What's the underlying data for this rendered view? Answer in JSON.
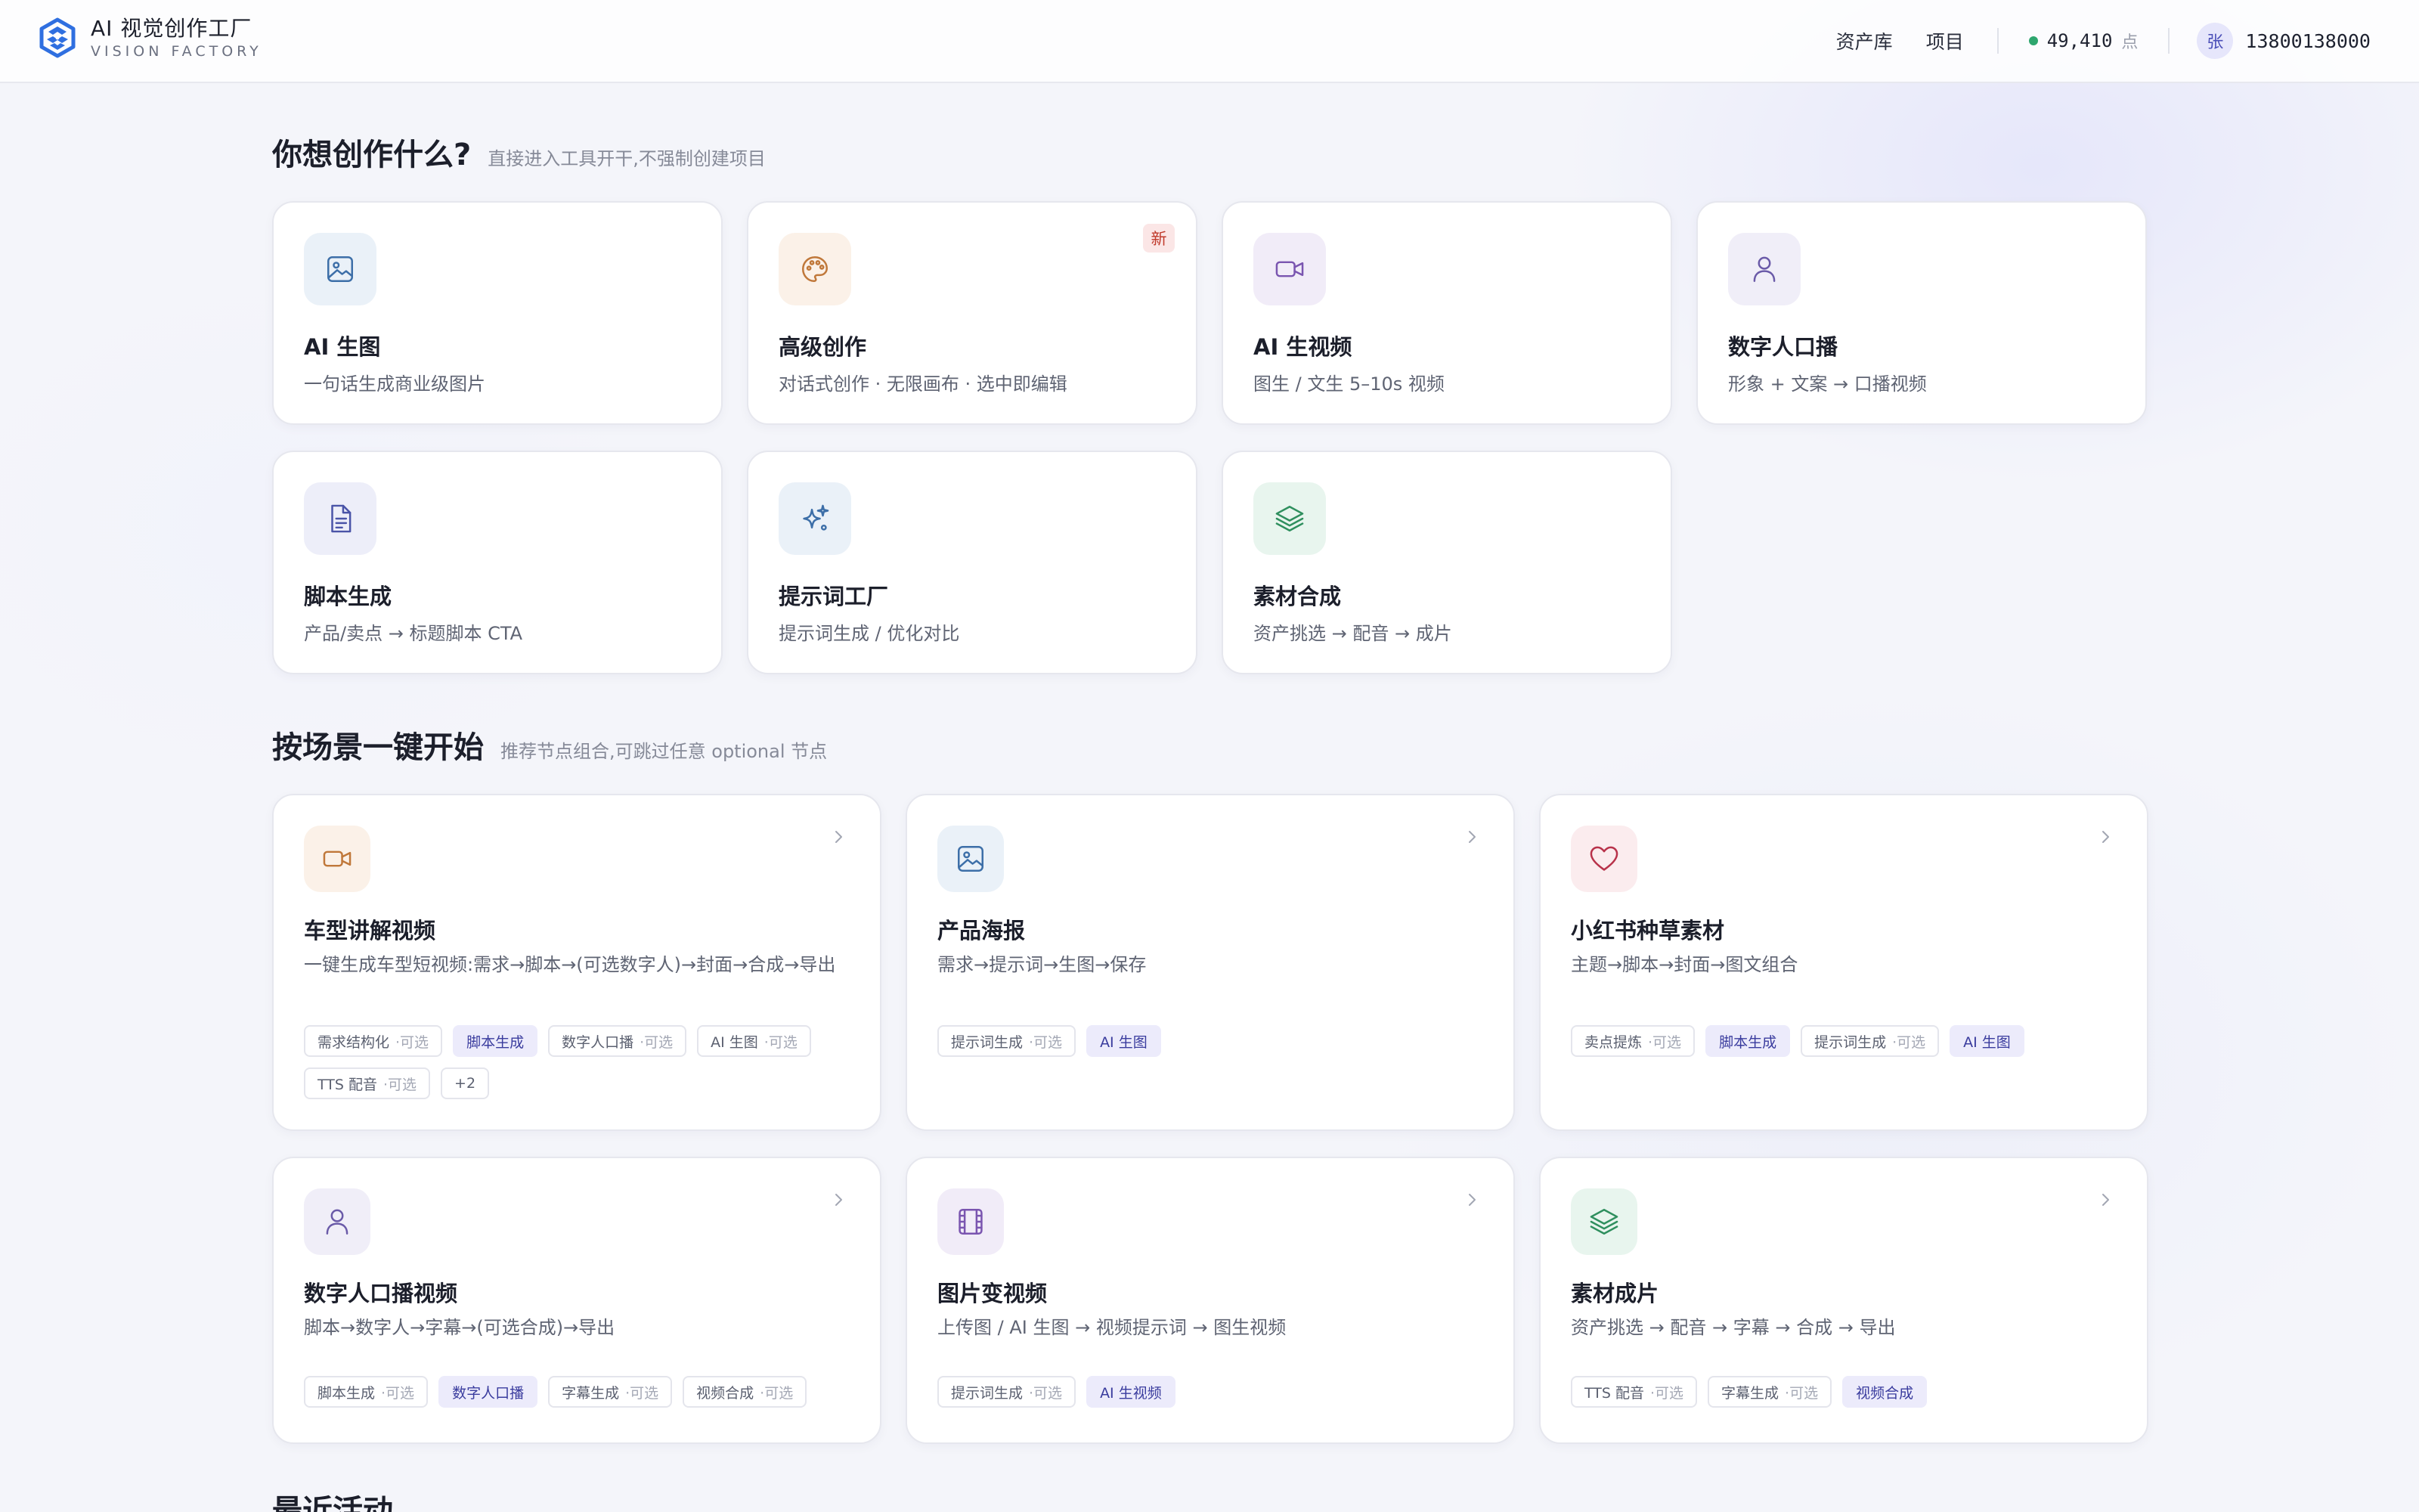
{
  "brand": {
    "title": "AI 视觉创作工厂",
    "subtitle": "VISION FACTORY"
  },
  "nav": {
    "assets": "资产库",
    "projects": "项目",
    "credits": "49,410",
    "credits_unit": "点",
    "avatar_initial": "张",
    "user_phone": "13800138000"
  },
  "tools_section": {
    "title": "你想创作什么?",
    "subtitle": "直接进入工具开干,不强制创建项目",
    "cards": [
      {
        "icon": "image-icon",
        "title": "AI 生图",
        "desc": "一句话生成商业级图片",
        "color": "#3d6fa8",
        "bg": "#eaf1f8"
      },
      {
        "icon": "palette-icon",
        "title": "高级创作",
        "desc": "对话式创作 · 无限画布 · 选中即编辑",
        "color": "#c0783a",
        "bg": "#fbf1e8",
        "badge": "新"
      },
      {
        "icon": "video-icon",
        "title": "AI 生视频",
        "desc": "图生 / 文生 5–10s 视频",
        "color": "#7a55b0",
        "bg": "#f1ecf8"
      },
      {
        "icon": "person-icon",
        "title": "数字人口播",
        "desc": "形象 + 文案 → 口播视频",
        "color": "#6a5aa8",
        "bg": "#f0eef8"
      },
      {
        "icon": "document-icon",
        "title": "脚本生成",
        "desc": "产品/卖点 → 标题脚本 CTA",
        "color": "#4a54a8",
        "bg": "#edeef9"
      },
      {
        "icon": "sparkles-icon",
        "title": "提示词工厂",
        "desc": "提示词生成 / 优化对比",
        "color": "#3d6fa8",
        "bg": "#eaf1f8"
      },
      {
        "icon": "layers-icon",
        "title": "素材合成",
        "desc": "资产挑选 → 配音 → 成片",
        "color": "#2f8f5e",
        "bg": "#e8f5ee"
      }
    ]
  },
  "scenes_section": {
    "title": "按场景一键开始",
    "subtitle": "推荐节点组合,可跳过任意 optional 节点",
    "cards": [
      {
        "icon": "video-icon",
        "color": "#c0783a",
        "bg": "#fbf1e8",
        "title": "车型讲解视频",
        "desc": "一键生成车型短视频:需求→脚本→(可选数字人)→封面→合成→导出",
        "chips": [
          {
            "label": "需求结构化",
            "opt": "·可选",
            "hl": false
          },
          {
            "label": "脚本生成",
            "opt": "",
            "hl": true
          },
          {
            "label": "数字人口播",
            "opt": "·可选",
            "hl": false
          },
          {
            "label": "AI 生图",
            "opt": "·可选",
            "hl": false
          },
          {
            "label": "TTS 配音",
            "opt": "·可选",
            "hl": false
          },
          {
            "label": "+2",
            "opt": "",
            "hl": false
          }
        ]
      },
      {
        "icon": "image-icon",
        "color": "#3d6fa8",
        "bg": "#eaf1f8",
        "title": "产品海报",
        "desc": "需求→提示词→生图→保存",
        "chips": [
          {
            "label": "提示词生成",
            "opt": "·可选",
            "hl": false
          },
          {
            "label": "AI 生图",
            "opt": "",
            "hl": true
          }
        ]
      },
      {
        "icon": "heart-icon",
        "color": "#b8324a",
        "bg": "#fbecee",
        "title": "小红书种草素材",
        "desc": "主题→脚本→封面→图文组合",
        "chips": [
          {
            "label": "卖点提炼",
            "opt": "·可选",
            "hl": false
          },
          {
            "label": "脚本生成",
            "opt": "",
            "hl": true
          },
          {
            "label": "提示词生成",
            "opt": "·可选",
            "hl": false
          },
          {
            "label": "AI 生图",
            "opt": "",
            "hl": true
          }
        ]
      },
      {
        "icon": "person-icon",
        "color": "#6a5aa8",
        "bg": "#f0eef8",
        "title": "数字人口播视频",
        "desc": "脚本→数字人→字幕→(可选合成)→导出",
        "chips": [
          {
            "label": "脚本生成",
            "opt": "·可选",
            "hl": false
          },
          {
            "label": "数字人口播",
            "opt": "",
            "hl": true
          },
          {
            "label": "字幕生成",
            "opt": "·可选",
            "hl": false
          },
          {
            "label": "视频合成",
            "opt": "·可选",
            "hl": false
          }
        ]
      },
      {
        "icon": "film-icon",
        "color": "#7a55b0",
        "bg": "#f1ecf8",
        "title": "图片变视频",
        "desc": "上传图 / AI 生图 → 视频提示词 → 图生视频",
        "chips": [
          {
            "label": "提示词生成",
            "opt": "·可选",
            "hl": false
          },
          {
            "label": "AI 生视频",
            "opt": "",
            "hl": true
          }
        ]
      },
      {
        "icon": "layers-icon",
        "color": "#2f8f5e",
        "bg": "#e8f5ee",
        "title": "素材成片",
        "desc": "资产挑选 → 配音 → 字幕 → 合成 → 导出",
        "chips": [
          {
            "label": "TTS 配音",
            "opt": "·可选",
            "hl": false
          },
          {
            "label": "字幕生成",
            "opt": "·可选",
            "hl": false
          },
          {
            "label": "视频合成",
            "opt": "",
            "hl": true
          }
        ]
      }
    ]
  },
  "recent_section": {
    "title": "最近活动"
  }
}
